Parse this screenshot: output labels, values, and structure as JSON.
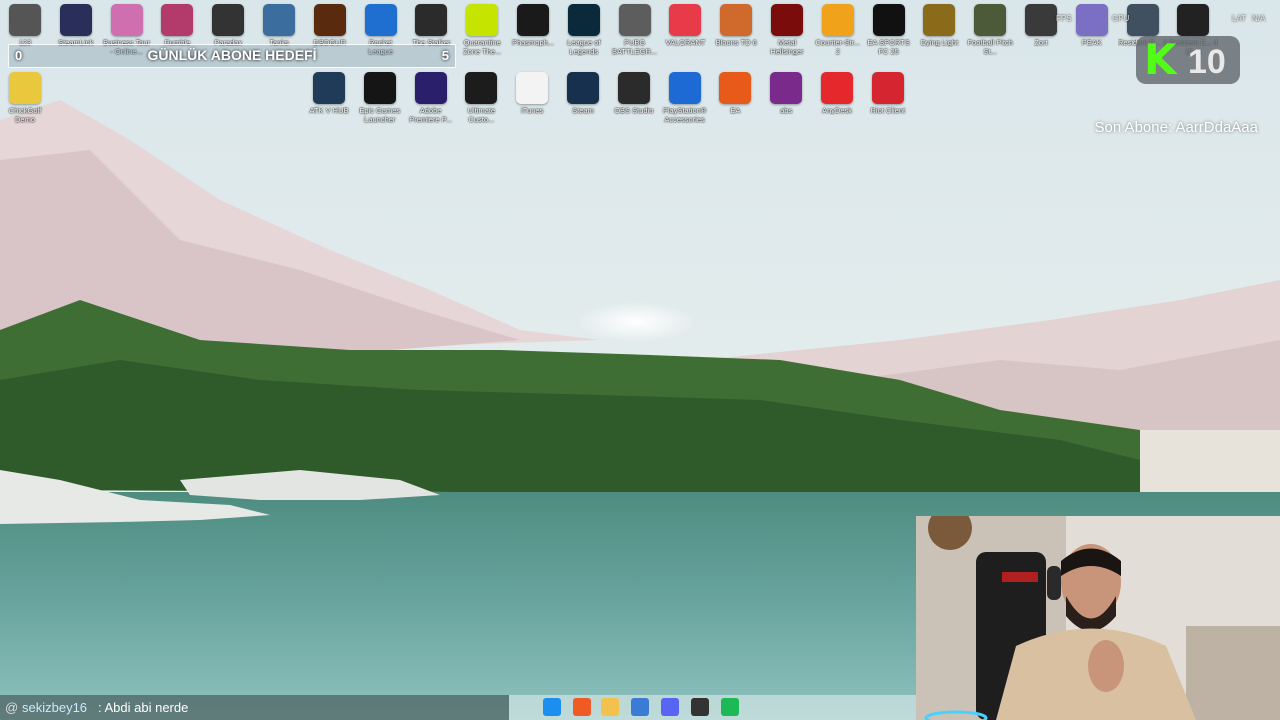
{
  "desktop": {
    "row1": [
      {
        "label": "123",
        "icon": "shortcut-icon",
        "color": "#555"
      },
      {
        "label": "SteamLink",
        "icon": "steamlink-icon",
        "color": "#2a2f5a"
      },
      {
        "label": "Business Tour - Online...",
        "icon": "business-tour-icon",
        "color": "#d06fb0"
      },
      {
        "label": "Rumble",
        "icon": "rumble-icon",
        "color": "#b23b6b"
      },
      {
        "label": "Paradox",
        "icon": "paradox-icon",
        "color": "#333"
      },
      {
        "label": "Tanks",
        "icon": "tanks-icon",
        "color": "#3b6d9e"
      },
      {
        "label": "DBDGUR",
        "icon": "dbd-icon",
        "color": "#5a2a0e"
      },
      {
        "label": "Rocket League",
        "icon": "rocket-league-icon",
        "color": "#1f6fd1"
      },
      {
        "label": "The Stalker",
        "icon": "stalker-icon",
        "color": "#2b2b2b"
      },
      {
        "label": "Quarantine Zone The...",
        "icon": "quarantine-icon",
        "color": "#c5e400"
      },
      {
        "label": "Phasmoph...",
        "icon": "phasmophobia-icon",
        "color": "#1a1a1a"
      },
      {
        "label": "League of Legends",
        "icon": "league-icon",
        "color": "#0a2a3c"
      },
      {
        "label": "PUBG BATTLEGR...",
        "icon": "pubg-icon",
        "color": "#5d5d5d"
      },
      {
        "label": "VALORANT",
        "icon": "valorant-icon",
        "color": "#e83b4a"
      },
      {
        "label": "Bloons TD 6",
        "icon": "bloons-icon",
        "color": "#cf6a2c"
      },
      {
        "label": "Metal Hellsinger",
        "icon": "metal-hellsinger-icon",
        "color": "#7a0c0c"
      },
      {
        "label": "Counter-Str... 2",
        "icon": "cs2-icon",
        "color": "#f0a21a"
      },
      {
        "label": "EA SPORTS FC 25",
        "icon": "eafc-icon",
        "color": "#111"
      },
      {
        "label": "Dying Light",
        "icon": "dying-light-icon",
        "color": "#8a6b1a"
      },
      {
        "label": "Football Pitch St...",
        "icon": "football-icon",
        "color": "#4d5a3a"
      },
      {
        "label": "Zort",
        "icon": "zort-icon",
        "color": "#3a3a3a"
      },
      {
        "label": "PEAK",
        "icon": "peak-icon",
        "color": "#7b6fc4"
      },
      {
        "label": "Resident E... 2",
        "icon": "resident-evil-icon",
        "color": "#405060"
      },
      {
        "label": "Resident E... 4 (2...)",
        "icon": "resident-evil-4-icon",
        "color": "#222"
      }
    ],
    "row2": [
      {
        "label": "ChickGolf Demo",
        "icon": "chick-golf-icon",
        "color": "#e9c83d"
      },
      {
        "label": "ATK V HUB",
        "icon": "atk-hub-icon",
        "color": "#1f3b57"
      },
      {
        "label": "Epic Games Launcher",
        "icon": "epic-games-icon",
        "color": "#151515"
      },
      {
        "label": "Adobe Premiere P...",
        "icon": "premiere-icon",
        "color": "#2a1f6b"
      },
      {
        "label": "Ultimate Custo...",
        "icon": "ultimate-custom-icon",
        "color": "#1c1c1c"
      },
      {
        "label": "iTunes",
        "icon": "itunes-icon",
        "color": "#f3f3f3"
      },
      {
        "label": "Steam",
        "icon": "steam-icon",
        "color": "#16304d"
      },
      {
        "label": "OBS Studio",
        "icon": "obs-icon",
        "color": "#2b2b2b"
      },
      {
        "label": "PlayStation® Accessories",
        "icon": "playstation-icon",
        "color": "#1d6ad4"
      },
      {
        "label": "EA",
        "icon": "ea-icon",
        "color": "#e85a1a"
      },
      {
        "label": "abs",
        "icon": "winrar-icon",
        "color": "#7a2a8a"
      },
      {
        "label": "AnyDesk",
        "icon": "anydesk-icon",
        "color": "#e4282b"
      },
      {
        "label": "Riot Client",
        "icon": "riot-icon",
        "color": "#d52530"
      }
    ]
  },
  "overlay": {
    "goal_title": "GÜNLÜK ABONE HEDEFİ",
    "goal_from": "0",
    "goal_to": "5",
    "kick_logo": "K",
    "kick_count": "10",
    "last_sub": "Son Abone: AarrDdaAaa",
    "hud_fps": "FPS",
    "hud_gpu": "GPU",
    "hud_lat": "LAT",
    "hud_lat_val": "N/A"
  },
  "chat": {
    "at": "@",
    "user": "sekizbey16",
    "message": ": Abdi abi nerde"
  },
  "taskbar": {
    "items": [
      {
        "icon": "windows-start-icon",
        "color": "#1b8ef0"
      },
      {
        "icon": "brave-icon",
        "color": "#f05a24"
      },
      {
        "icon": "file-explorer-icon",
        "color": "#f2c14e"
      },
      {
        "icon": "network-icon",
        "color": "#3a7bd5"
      },
      {
        "icon": "discord-icon",
        "color": "#5865f2"
      },
      {
        "icon": "obs-taskbar-icon",
        "color": "#333"
      },
      {
        "icon": "spotify-icon",
        "color": "#1db954"
      }
    ]
  }
}
